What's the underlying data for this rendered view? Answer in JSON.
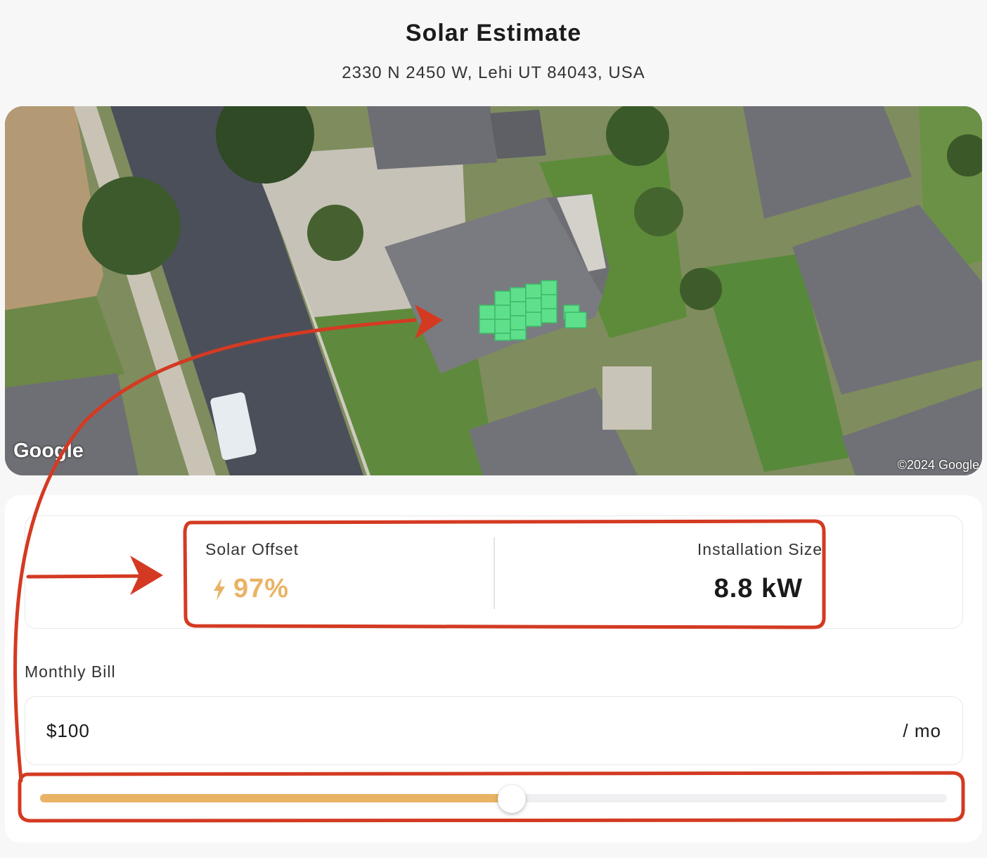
{
  "header": {
    "title": "Solar Estimate",
    "address": "2330 N 2450 W, Lehi UT 84043, USA"
  },
  "map": {
    "logo": "Google",
    "copyright": "©2024 Google",
    "panel_color": "#5ee08a"
  },
  "stats": {
    "solar_offset_label": "Solar Offset",
    "solar_offset_value": "97%",
    "installation_size_label": "Installation Size",
    "installation_size_value": "8.8 kW"
  },
  "bill": {
    "label": "Monthly Bill",
    "value": "$100",
    "unit": "/ mo",
    "slider_fraction": 0.52
  },
  "colors": {
    "accent": "#e9b366",
    "annotation": "#d43a22"
  },
  "icons": {
    "offset": "lightning-bolt-icon"
  }
}
